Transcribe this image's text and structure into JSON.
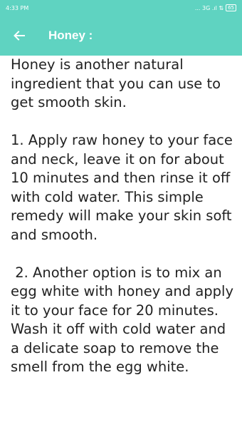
{
  "status_bar": {
    "time": "4:33 PM",
    "indicators": "...  3G .ıl  ⇅",
    "battery": "65"
  },
  "app_bar": {
    "title": "Honey :",
    "back_icon": "arrow-left-icon"
  },
  "content": {
    "intro": "Honey is another natural ingredient that you can use to get smooth skin.",
    "step1": "1. Apply raw honey to your face and neck, leave it on for about 10 minutes and then rinse it off with cold water. This simple remedy will make your skin soft and smooth.",
    "step2": " 2. Another option is to mix an egg white with honey and apply it to your face for 20 minutes. Wash it off with cold water and a delicate soap to remove the smell from the egg white."
  },
  "colors": {
    "accent": "#5fd3c1",
    "text": "#222222"
  }
}
